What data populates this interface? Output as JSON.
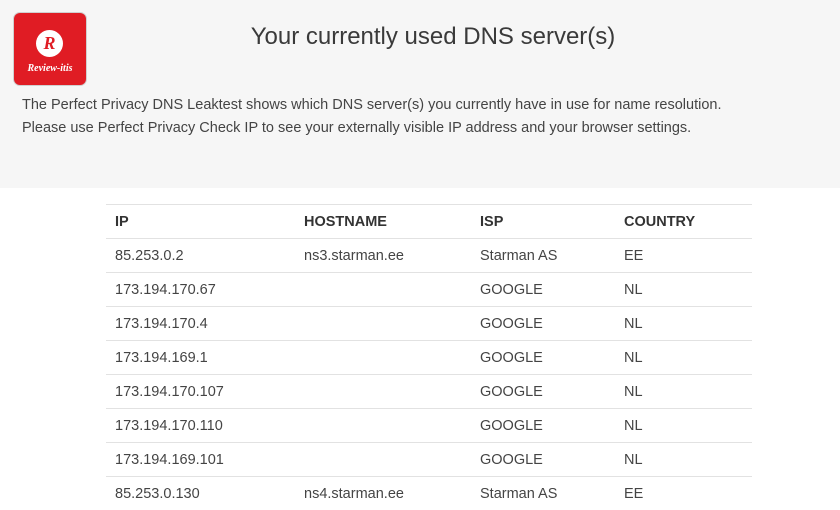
{
  "logo": {
    "letter": "R",
    "text": "Review-itis"
  },
  "header": {
    "title": "Your currently used DNS server(s)"
  },
  "description": {
    "line1": "The Perfect Privacy DNS Leaktest shows which DNS server(s) you currently have in use for name resolution.",
    "line2": "Please use Perfect Privacy Check IP to see your externally visible IP address and your browser settings."
  },
  "table": {
    "columns": [
      "IP",
      "HOSTNAME",
      "ISP",
      "COUNTRY"
    ],
    "rows": [
      [
        "85.253.0.2",
        "ns3.starman.ee",
        "Starman AS",
        "EE"
      ],
      [
        "173.194.170.67",
        "",
        "GOOGLE",
        "NL"
      ],
      [
        "173.194.170.4",
        "",
        "GOOGLE",
        "NL"
      ],
      [
        "173.194.169.1",
        "",
        "GOOGLE",
        "NL"
      ],
      [
        "173.194.170.107",
        "",
        "GOOGLE",
        "NL"
      ],
      [
        "173.194.170.110",
        "",
        "GOOGLE",
        "NL"
      ],
      [
        "173.194.169.101",
        "",
        "GOOGLE",
        "NL"
      ],
      [
        "85.253.0.130",
        "ns4.starman.ee",
        "Starman AS",
        "EE"
      ]
    ]
  }
}
